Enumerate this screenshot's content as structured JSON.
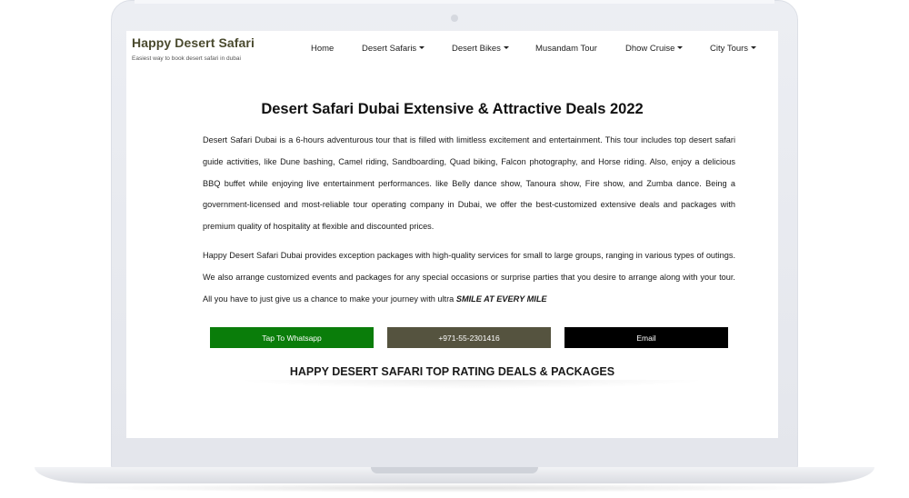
{
  "brand": {
    "name": "Happy Desert Safari",
    "tagline": "Easiest way to book desert safari in dubai"
  },
  "nav": {
    "items": [
      {
        "label": "Home",
        "dropdown": false
      },
      {
        "label": "Desert Safaris",
        "dropdown": true
      },
      {
        "label": "Desert Bikes",
        "dropdown": true
      },
      {
        "label": "Musandam Tour",
        "dropdown": false
      },
      {
        "label": "Dhow Cruise",
        "dropdown": true
      },
      {
        "label": "City Tours",
        "dropdown": true
      }
    ]
  },
  "main": {
    "heading": "Desert Safari Dubai Extensive & Attractive Deals 2022",
    "paragraph1": "Desert Safari Dubai is a 6-hours adventurous tour that is filled with limitless excitement and entertainment. This tour includes top desert safari guide activities, like Dune bashing, Camel riding, Sandboarding, Quad biking, Falcon photography, and Horse riding. Also, enjoy a delicious BBQ buffet while enjoying live entertainment performances. like Belly dance show, Tanoura show, Fire show, and Zumba dance. Being a government-licensed and most-reliable tour operating company in Dubai, we offer the best-customized extensive deals and packages with premium quality of hospitality at flexible and discounted prices.",
    "paragraph2": "Happy Desert Safari Dubai provides exception packages with high-quality services for small to large groups, ranging in various types of outings. We also arrange customized events and packages for any special occasions or surprise parties that you desire to arrange along with your tour. All you have to just give us a chance to make your journey with ultra ",
    "paragraph2_emphasis": "SMILE AT EVERY MILE",
    "subheading": "HAPPY DESERT SAFARI TOP RATING DEALS & PACKAGES"
  },
  "cta": {
    "whatsapp_label": "Tap To Whatsapp",
    "phone_label": "+971-55-2301416",
    "email_label": "Email"
  },
  "colors": {
    "whatsapp": "#0a7d0a",
    "phone": "#55533f",
    "email": "#000000",
    "brand": "#4a4a2e"
  },
  "icons": [
    "caret-down-icon",
    "camera-icon"
  ]
}
